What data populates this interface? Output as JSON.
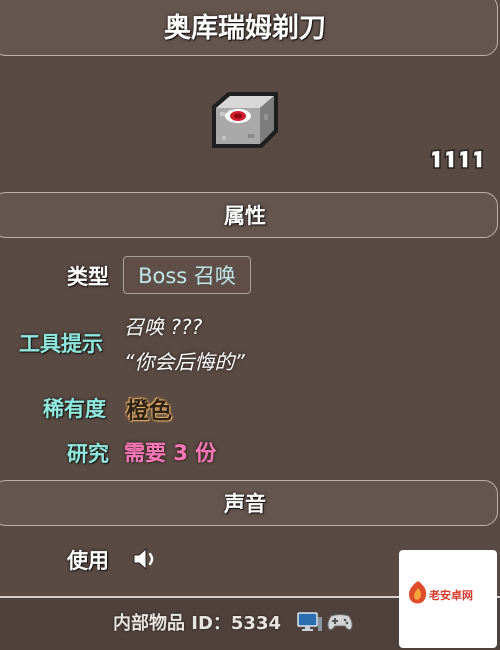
{
  "item": {
    "name": "奥库瑞姆剃刀",
    "stack_count": "1111"
  },
  "sections": {
    "attributes": "属性",
    "sound": "声音"
  },
  "fields": {
    "type_label": "类型",
    "type_value": "Boss 召唤",
    "tooltip_label": "工具提示",
    "tooltip_line1": "召唤 ???",
    "tooltip_line2": "“你会后悔的”",
    "rarity_label": "稀有度",
    "rarity_value": "橙色",
    "research_label": "研究",
    "research_value": "需要 3 份",
    "use_label": "使用"
  },
  "footer": {
    "internal_id": "内部物品 ID：5334"
  },
  "watermark": {
    "text": "老安卓网"
  },
  "icons": {
    "item_sprite": "razor-item-icon",
    "use_sound": "speaker-icon",
    "pc": "pc-icon",
    "console": "gamepad-icon"
  },
  "colors": {
    "background": "#594a43",
    "section_band": "#64554e",
    "label_cyan": "#8fe9de",
    "rarity_orange": "#d8a15e",
    "research_pink": "#ff79b8"
  }
}
